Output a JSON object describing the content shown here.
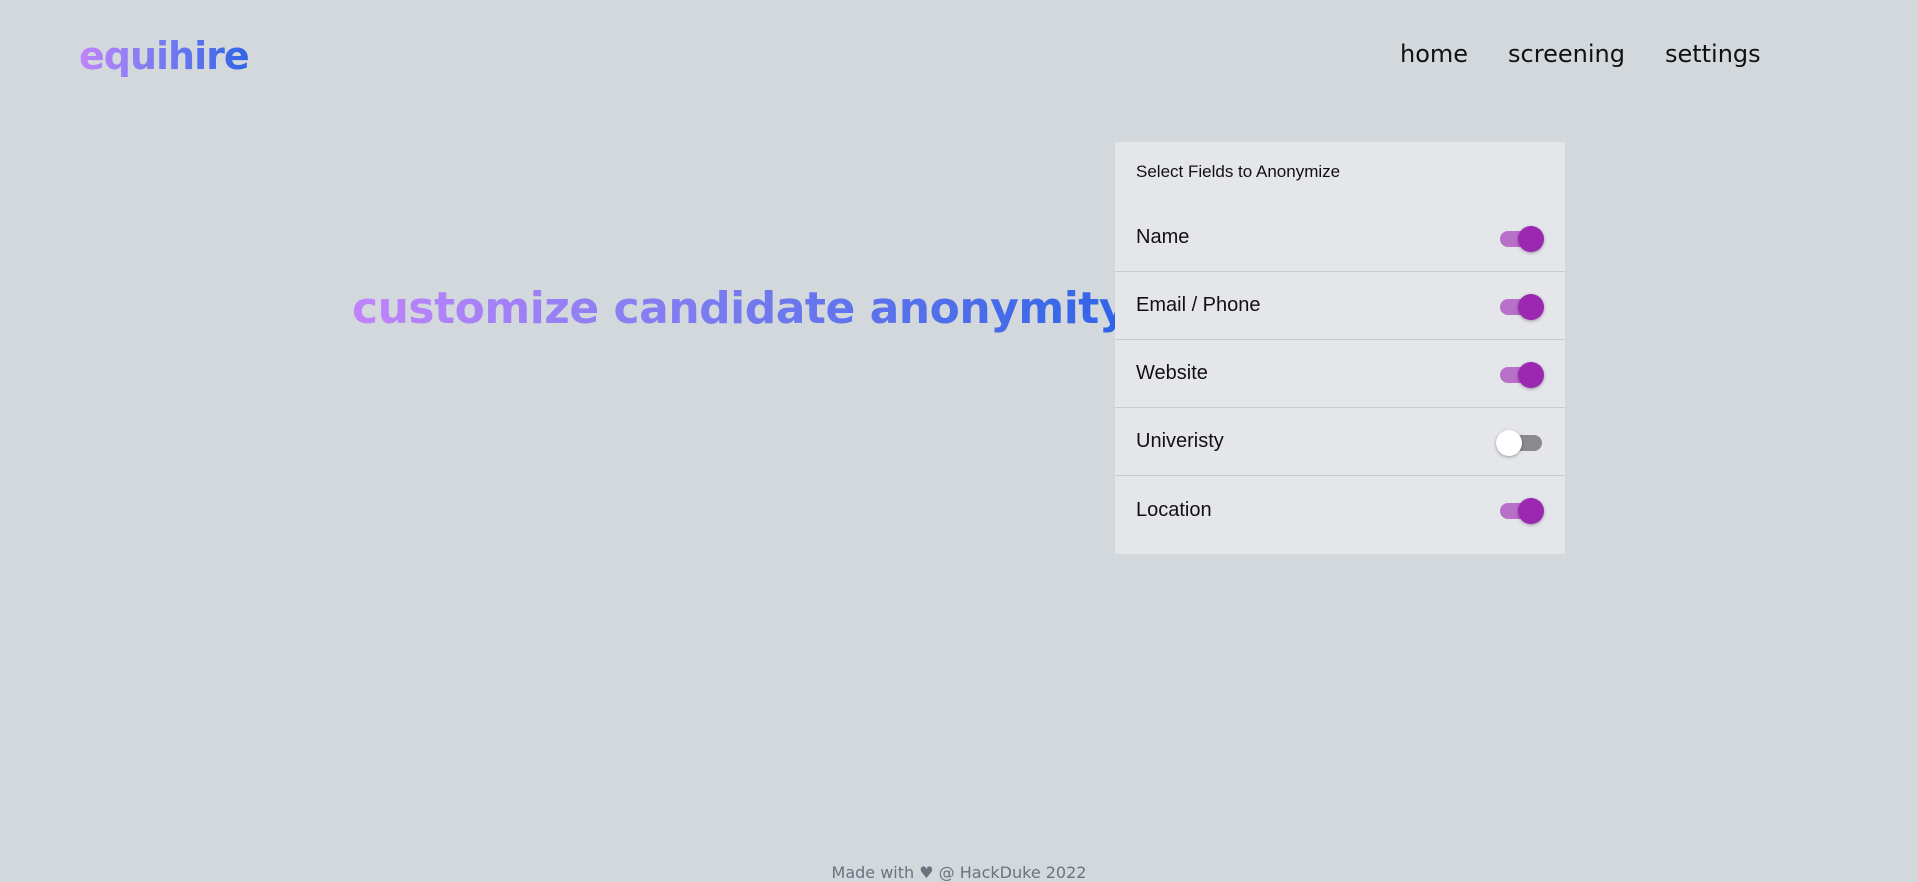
{
  "brand": {
    "logo_text": "equihire"
  },
  "nav": {
    "items": [
      {
        "label": "home"
      },
      {
        "label": "screening"
      },
      {
        "label": "settings"
      }
    ]
  },
  "main": {
    "headline": "customize candidate anonymity"
  },
  "panel": {
    "title": "Select Fields to Anonymize",
    "fields": [
      {
        "label": "Name",
        "enabled": true
      },
      {
        "label": "Email / Phone",
        "enabled": true
      },
      {
        "label": "Website",
        "enabled": true
      },
      {
        "label": "Univeristy",
        "enabled": false
      },
      {
        "label": "Location",
        "enabled": true
      }
    ]
  },
  "colors": {
    "gradient_start": "#c084fc",
    "gradient_end": "#2f64e6",
    "toggle_on": "#9c27b0",
    "background": "#d3d8dc"
  },
  "footer": {
    "text": "Made with ♥ @ HackDuke 2022"
  }
}
